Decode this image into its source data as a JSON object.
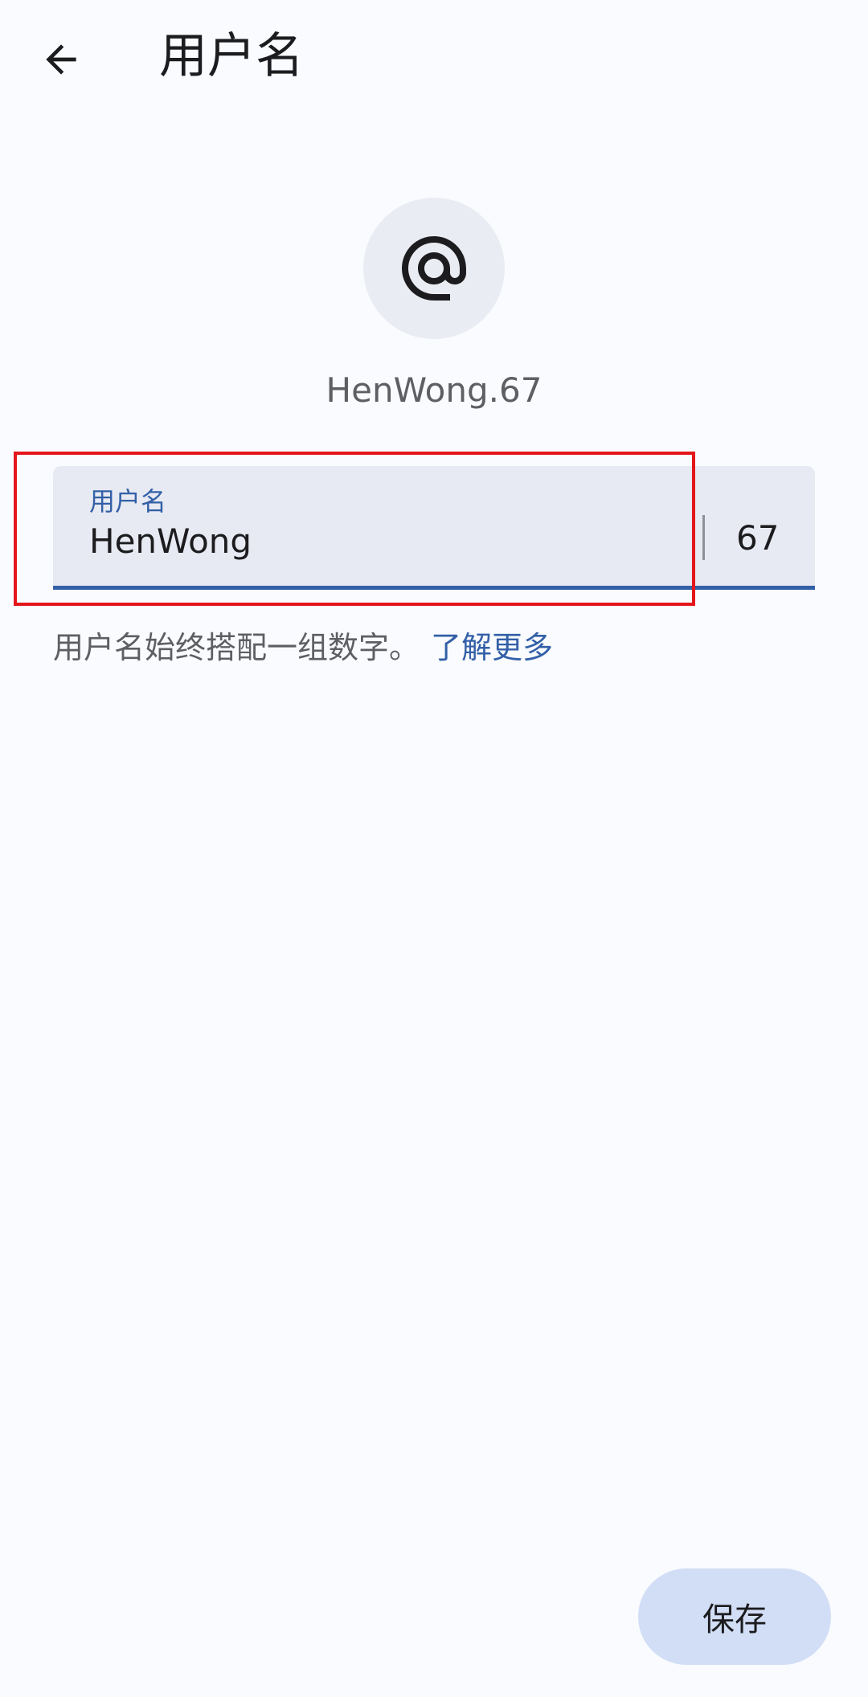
{
  "header": {
    "title": "用户名",
    "back_icon": "arrow-back-icon"
  },
  "avatar": {
    "icon": "at-sign-icon"
  },
  "full_username": "HenWong.67",
  "username_field": {
    "label": "用户名",
    "value": "HenWong",
    "suffix": "67"
  },
  "helper": {
    "text": "用户名始终搭配一组数字。",
    "link": "了解更多"
  },
  "save_label": "保存",
  "colors": {
    "background": "#f9fbfe",
    "accent": "#3360a7",
    "field_bg": "#e7eaf2",
    "button_bg": "#d2def6",
    "highlight": "#e4161b"
  }
}
